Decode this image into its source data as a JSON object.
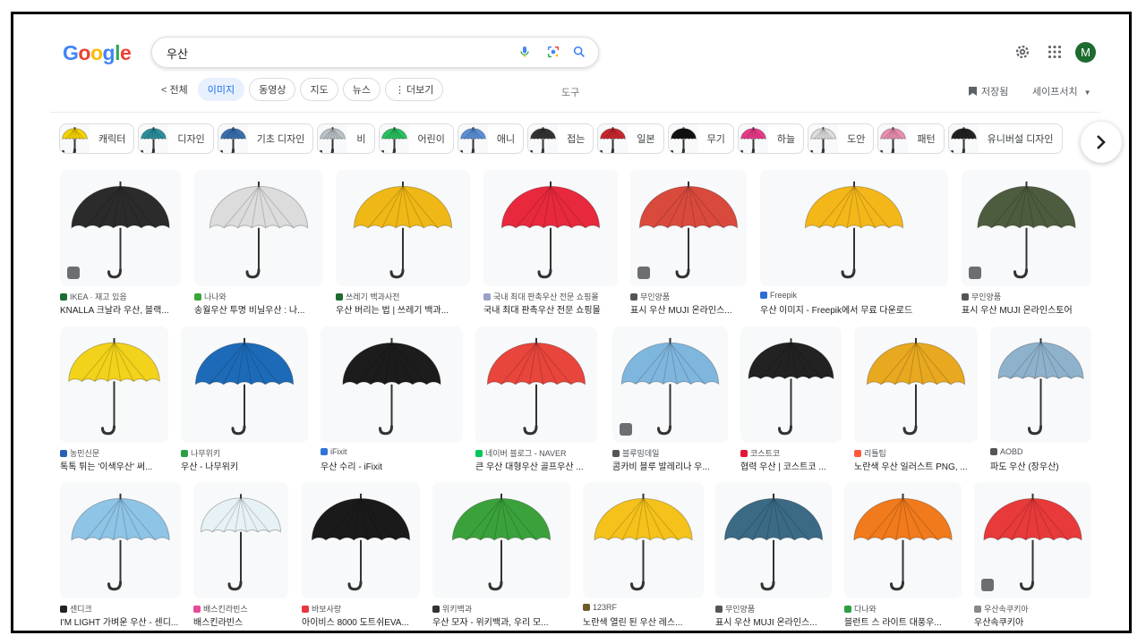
{
  "header": {
    "logo_letters": [
      "G",
      "o",
      "o",
      "g",
      "l",
      "e"
    ],
    "search_value": "우산",
    "avatar_letter": "M",
    "icons": [
      "mic-icon",
      "lens-icon",
      "search-icon",
      "settings-icon",
      "apps-icon"
    ]
  },
  "tabs": {
    "back_label": "< 전체",
    "items": [
      "이미지",
      "동영상",
      "지도",
      "뉴스",
      "더보기"
    ],
    "active": "이미지",
    "more_prefix": "⋮",
    "tools": "도구",
    "saved": "저장됨",
    "safe_search": "세이프서치"
  },
  "chips": [
    {
      "label": "캐릭터",
      "color": "#f5d300"
    },
    {
      "label": "디자인",
      "color": "#2a8f9c"
    },
    {
      "label": "기초 디자인",
      "color": "#3a6fb0"
    },
    {
      "label": "비",
      "color": "#b9c2c7"
    },
    {
      "label": "어린이",
      "color": "#28c060"
    },
    {
      "label": "애니",
      "color": "#5b8fd6"
    },
    {
      "label": "접는",
      "color": "#333333"
    },
    {
      "label": "일본",
      "color": "#c8282d"
    },
    {
      "label": "무기",
      "color": "#111111"
    },
    {
      "label": "하늘",
      "color": "#e83a8a"
    },
    {
      "label": "도안",
      "color": "#dddddd"
    },
    {
      "label": "패턴",
      "color": "#e98fb0"
    },
    {
      "label": "유니버설 디자인",
      "color": "#222222"
    }
  ],
  "rows": [
    [
      {
        "source": "IKEA · 재고 있음",
        "title": "KNALLA 크날라 우산, 블랙...",
        "color": "#2b2b2b",
        "fav": "#1b6d34"
      },
      {
        "source": "나나와",
        "title": "송월우산 투명 비닐우산 : 나...",
        "color": "#dcdcdc",
        "fav": "#3aa63a"
      },
      {
        "source": "쓰레기 백과사전",
        "title": "우산 버리는 법 | 쓰레기 백과...",
        "color": "#f0b816",
        "fav": "#1f6a32"
      },
      {
        "source": "국내 최대 판촉우산 전문 쇼핑몰",
        "title": "국내 최대 판촉우산 전문 쇼핑몰",
        "color": "#e8293d",
        "fav": "#9aa0c8"
      },
      {
        "source": "무인양품",
        "title": "표시 우산 MUJI 온라인스...",
        "color": "#d94a3d",
        "fav": "#555555"
      },
      {
        "source": "Freepik",
        "title": "우산 이미지 - Freepik에서 무료 다운로드",
        "color": "#f4b71a",
        "fav": "#2a6ed6"
      },
      {
        "source": "무인양품",
        "title": "표시 우산 MUJI 온라인스토어",
        "color": "#4d5c3e",
        "fav": "#555555"
      }
    ],
    [
      {
        "source": "농민신문",
        "title": "톡톡 튀는 '이색우산' 써...",
        "color": "#f2d21a",
        "fav": "#2a5fb8"
      },
      {
        "source": "나무위키",
        "title": "우산 - 나무위키",
        "color": "#1d6bb8",
        "fav": "#2ea043"
      },
      {
        "source": "iFixit",
        "title": "우산 수리 - iFixit",
        "color": "#1c1c1c",
        "fav": "#2f73d6"
      },
      {
        "source": "네이버 블로그 - NAVER",
        "title": "큰 우산 대형우산 골프우산 ...",
        "color": "#e8453c",
        "fav": "#03c75a"
      },
      {
        "source": "블루밍데일",
        "title": "콤카비 블루 발레리나 우...",
        "color": "#7fb6de",
        "fav": "#555555"
      },
      {
        "source": "코스트코",
        "title": "협력 우산 | 코스트코 ...",
        "color": "#222222",
        "fav": "#e31837"
      },
      {
        "source": "리틀팁",
        "title": "노란색 우산 일러스트 PNG, ...",
        "color": "#e8a820",
        "fav": "#ff5a3c"
      },
      {
        "source": "AOBD",
        "title": "파도 우산 (장우산)",
        "color": "#8fb2cc",
        "fav": "#555555"
      }
    ],
    [
      {
        "source": "센디크",
        "title": "I'M LIGHT 가벼운 우산 - 센디...",
        "color": "#8ec4e6",
        "fav": "#222222"
      },
      {
        "source": "배스킨라빈스",
        "title": "배스킨라빈스",
        "color": "#e7f2f6",
        "fav": "#e64a97"
      },
      {
        "source": "바보사랑",
        "title": "아이비스 8000 도트쉬EVA...",
        "color": "#1a1a1a",
        "fav": "#e8383d"
      },
      {
        "source": "위키백과",
        "title": "우산 모자 - 위키백과, 우리 모...",
        "color": "#3ba23b",
        "fav": "#333333"
      },
      {
        "source": "123RF",
        "title": "노란색 열린 된 우산 레스...",
        "color": "#f5c21b",
        "fav": "#6b5a2a"
      },
      {
        "source": "무인양품",
        "title": "표시 우산 MUJI 온라인스...",
        "color": "#3b6a85",
        "fav": "#555555"
      },
      {
        "source": "다나와",
        "title": "블런트 스 라이트 대풍우...",
        "color": "#f07a1c",
        "fav": "#2ea043"
      },
      {
        "source": "우산속쿠키아",
        "title": "우산속쿠키아",
        "color": "#e83a3a",
        "fav": "#888888"
      }
    ]
  ]
}
